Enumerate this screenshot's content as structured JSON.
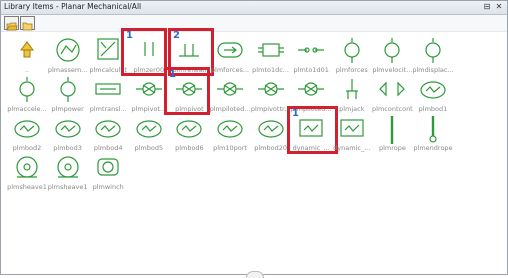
{
  "window": {
    "title": "Library Items - Planar Mechanical/All",
    "pin_glyph": "⊟",
    "close_glyph": "✕"
  },
  "toolbar": {
    "tools": [
      {
        "name": "open-folder-icon"
      },
      {
        "name": "folder-icon"
      }
    ]
  },
  "colors": {
    "symbol": "#2e9a3a",
    "highlight": "#d22030",
    "step_number": "#2a6cc9"
  },
  "items": [
    {
      "label": "..",
      "icon": "up-folder-icon"
    },
    {
      "label": "plmassem...",
      "icon": "assembly-icon"
    },
    {
      "label": "plmcalculat",
      "icon": "calculator-icon"
    },
    {
      "label": "plmzer00",
      "icon": "zero-ground-icon",
      "step": "1"
    },
    {
      "label": "plmrefwall",
      "icon": "ref-wall-icon",
      "step": "2"
    },
    {
      "label": "plmforces...",
      "icon": "forces-icon"
    },
    {
      "label": "plmto1dc...",
      "icon": "to1d-icon"
    },
    {
      "label": "plmto1d01",
      "icon": "to1d-arrow-icon"
    },
    {
      "label": "plmforces",
      "icon": "force-source-icon"
    },
    {
      "label": "plmvelocit...",
      "icon": "velocity-source-icon"
    },
    {
      "label": "plmdisplac...",
      "icon": "displacement-source-icon"
    },
    {
      "label": "plmaccele...",
      "icon": "acceleration-source-icon"
    },
    {
      "label": "plmpower",
      "icon": "power-source-icon"
    },
    {
      "label": "plmtransl...",
      "icon": "translation-icon"
    },
    {
      "label": "plmpivot...",
      "icon": "pivot-icon"
    },
    {
      "label": "plmpivot",
      "icon": "pivot-joint-icon",
      "step": "1"
    },
    {
      "label": "plmpiloted...",
      "icon": "piloted-joint-icon"
    },
    {
      "label": "plmpivottr...",
      "icon": "pivot-translation-icon"
    },
    {
      "label": "plmpiloted...",
      "icon": "piloted-pivot-icon"
    },
    {
      "label": "plmjack",
      "icon": "jack-icon"
    },
    {
      "label": "plmcontcont",
      "icon": "contact-icon"
    },
    {
      "label": "plmbod1",
      "icon": "body1-icon"
    },
    {
      "label": "plmbod2",
      "icon": "body2-icon"
    },
    {
      "label": "plmbod3",
      "icon": "body3-icon"
    },
    {
      "label": "plmbod4",
      "icon": "body4-icon"
    },
    {
      "label": "plmbod5",
      "icon": "body5-icon"
    },
    {
      "label": "plmbod6",
      "icon": "body6-icon"
    },
    {
      "label": "plm10port",
      "icon": "body10port-icon"
    },
    {
      "label": "plmbod20",
      "icon": "body20-icon"
    },
    {
      "label": "dynamic_...",
      "icon": "dynamic-body-icon",
      "step": "1"
    },
    {
      "label": "dynamic_...",
      "icon": "dynamic-body-2-icon"
    },
    {
      "label": "plmrope",
      "icon": "rope-icon"
    },
    {
      "label": "plmendrope",
      "icon": "end-rope-icon"
    },
    {
      "label": "plmsheave1",
      "icon": "sheave1-icon"
    },
    {
      "label": "plmsheave1",
      "icon": "sheave2-icon"
    },
    {
      "label": "plmwinch",
      "icon": "winch-icon"
    }
  ]
}
